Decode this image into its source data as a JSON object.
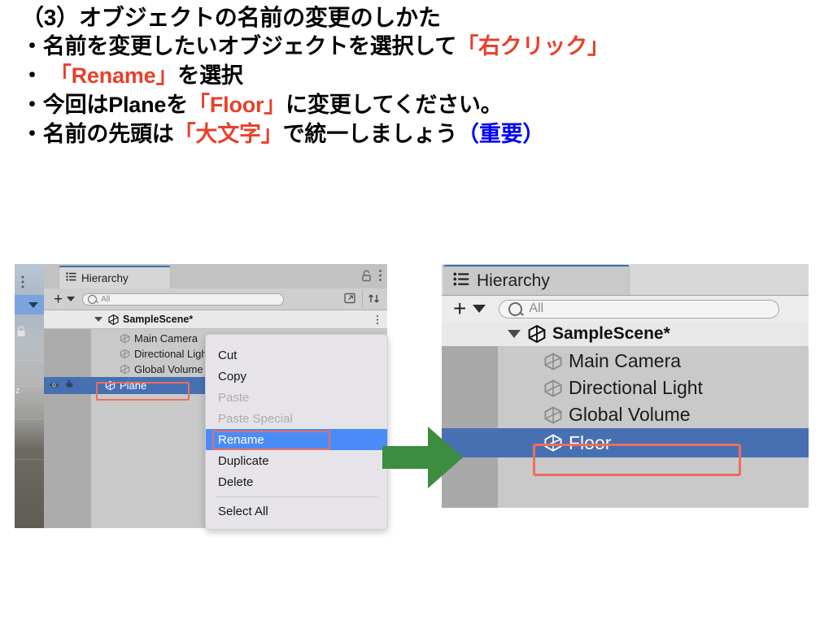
{
  "slide": {
    "heading": "（3）オブジェクトの名前の変更のしかた",
    "bullets": [
      {
        "parts": [
          {
            "t": "・名前を変更したいオブジェクトを選択して",
            "c": "black"
          },
          {
            "t": "「右クリック」",
            "c": "red"
          }
        ]
      },
      {
        "parts": [
          {
            "t": "・",
            "c": "black"
          },
          {
            "t": "「Rename」",
            "c": "red"
          },
          {
            "t": "を選択",
            "c": "black"
          }
        ]
      },
      {
        "parts": [
          {
            "t": "・今回はPlaneを",
            "c": "black"
          },
          {
            "t": "「Floor」",
            "c": "red"
          },
          {
            "t": "に変更してください。",
            "c": "black"
          }
        ]
      },
      {
        "parts": [
          {
            "t": "・名前の先頭は",
            "c": "black"
          },
          {
            "t": "「大文字」",
            "c": "red"
          },
          {
            "t": "で統一しましょう",
            "c": "black"
          },
          {
            "t": "（重要）",
            "c": "blue"
          }
        ]
      }
    ],
    "colors": {
      "red": "#E8402A",
      "blue": "#0000F5",
      "black": "#000000"
    }
  },
  "left_panel": {
    "tab_label": "Hierarchy",
    "tab_icon": "hierarchy-icon",
    "lock_icon": "lock-icon",
    "kebab_icon": "kebab-menu-icon",
    "add_label": "+",
    "search_placeholder": "All",
    "search_value": "",
    "scene_root": "SampleScene*",
    "rows": [
      {
        "label": "Main Camera",
        "selected": false
      },
      {
        "label": "Directional Light",
        "selected": false
      },
      {
        "label": "Global Volume",
        "selected": false
      },
      {
        "label": "Plane",
        "selected": true
      }
    ],
    "highlight_label": "Plane",
    "highlight_color": "#EF6D5C",
    "selection_color": "#4770B3"
  },
  "context_menu": {
    "items": [
      {
        "label": "Cut",
        "state": "normal"
      },
      {
        "label": "Copy",
        "state": "normal"
      },
      {
        "label": "Paste",
        "state": "disabled"
      },
      {
        "label": "Paste Special",
        "state": "disabled"
      },
      {
        "label": "Rename",
        "state": "highlighted"
      },
      {
        "label": "Duplicate",
        "state": "normal"
      },
      {
        "label": "Delete",
        "state": "normal"
      },
      {
        "label": "Select All",
        "state": "normal"
      }
    ],
    "highlight_color": "#4A8CF7",
    "outline_color": "#EF6D5C"
  },
  "arrow": {
    "name": "green-right-arrow",
    "color": "#3D8C40"
  },
  "right_panel": {
    "tab_label": "Hierarchy",
    "tab_icon": "hierarchy-icon",
    "add_label": "+",
    "search_placeholder": "All",
    "search_value": "",
    "scene_root": "SampleScene*",
    "rows": [
      {
        "label": "Main Camera",
        "selected": false
      },
      {
        "label": "Directional Light",
        "selected": false
      },
      {
        "label": "Global Volume",
        "selected": false
      },
      {
        "label": "Floor",
        "selected": true
      }
    ],
    "highlight_label": "Floor",
    "highlight_color": "#EF6D5C",
    "selection_color": "#4770B3"
  }
}
